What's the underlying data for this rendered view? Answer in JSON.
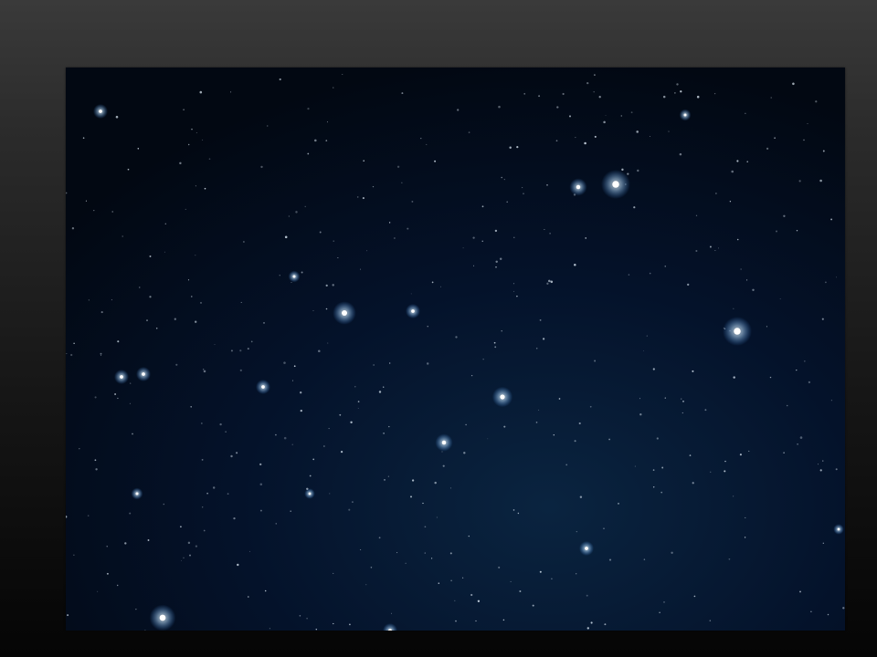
{
  "background": {
    "top_color": "#3a3a3a",
    "bottom_color": "#050505"
  },
  "photo": {
    "subject": "night-sky-starfield",
    "sky_colors": [
      "#020812",
      "#04122a",
      "#0a2440"
    ],
    "star_color": "#e8f4ff",
    "glow_color": "#8cc8ff"
  }
}
